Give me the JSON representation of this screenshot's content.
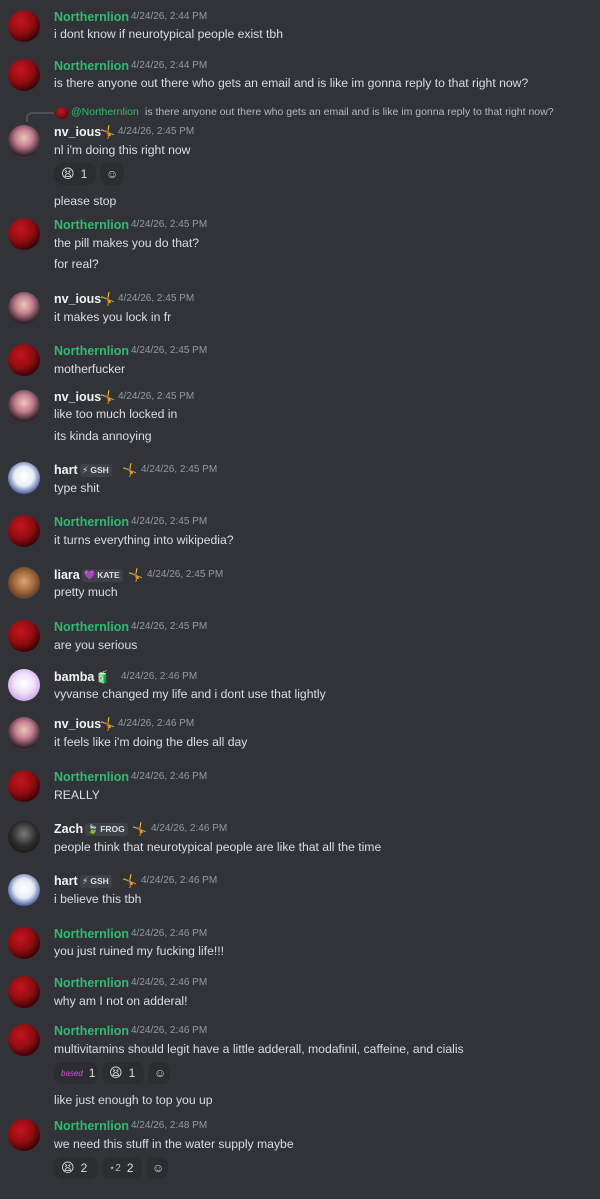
{
  "colors": {
    "background": "#313338",
    "northernlion": "#2dbd6e",
    "timestamp": "#949ba4",
    "text": "#dbdee1"
  },
  "messages": [
    {
      "name": "Northernlion",
      "time": "4/24/26, 2:44 PM",
      "text": "i dont know if neurotypical people exist tbh"
    },
    {
      "name": "Northernlion",
      "time": "4/24/26, 2:44 PM",
      "text": "is there anyone out there who gets an email and is like im gonna reply to that right now?"
    },
    {
      "reply_name": "@Northernlion",
      "reply_text": "is there anyone out there who gets an email and is like im gonna reply to that right now?",
      "name": "nv_ious",
      "time": "4/24/26, 2:45 PM",
      "text": "nl i'm doing this right now",
      "reaction_count": "1",
      "extra": "please stop"
    },
    {
      "name": "Northernlion",
      "time": "4/24/26, 2:45 PM",
      "text": "the pill makes you do that?",
      "extra": "for real?"
    },
    {
      "name": "nv_ious",
      "time": "4/24/26, 2:45 PM",
      "text": "it makes you lock in fr"
    },
    {
      "name": "Northernlion",
      "time": "4/24/26, 2:45 PM",
      "text": "motherfucker"
    },
    {
      "name": "nv_ious",
      "time": "4/24/26, 2:45 PM",
      "text": "like too much locked in",
      "extra": "its kinda annoying"
    },
    {
      "name": "hart",
      "tag": "GSH",
      "time": "4/24/26, 2:45 PM",
      "text": "type shit"
    },
    {
      "name": "Northernlion",
      "time": "4/24/26, 2:45 PM",
      "text": "it turns everything into wikipedia?"
    },
    {
      "name": "liara",
      "tag": "KATE",
      "time": "4/24/26, 2:45 PM",
      "text": "pretty much"
    },
    {
      "name": "Northernlion",
      "time": "4/24/26, 2:45 PM",
      "text": "are you serious"
    },
    {
      "name": "bamba",
      "time": "4/24/26, 2:46 PM",
      "text": "vyvanse changed my life and i dont use that lightly"
    },
    {
      "name": "nv_ious",
      "time": "4/24/26, 2:46 PM",
      "text": "it feels like i'm doing the dles all day"
    },
    {
      "name": "Northernlion",
      "time": "4/24/26, 2:46 PM",
      "text": "REALLY"
    },
    {
      "name": "Zach",
      "tag": "FROG",
      "time": "4/24/26, 2:46 PM",
      "text": "people think that neurotypical people are like that all the time"
    },
    {
      "name": "hart",
      "tag": "GSH",
      "time": "4/24/26, 2:46 PM",
      "text": "i believe this tbh"
    },
    {
      "name": "Northernlion",
      "time": "4/24/26, 2:46 PM",
      "text": "you just ruined my fucking life!!!"
    },
    {
      "name": "Northernlion",
      "time": "4/24/26, 2:46 PM",
      "text": "why am I not on adderal!"
    },
    {
      "name": "Northernlion",
      "time": "4/24/26, 2:46 PM",
      "text": "multivitamins should legit have a little adderall, modafinil, caffeine, and cialis",
      "reactions": [
        {
          "label": "based",
          "count": "1"
        },
        {
          "count": "1"
        }
      ],
      "extra": "like just enough to top you up"
    },
    {
      "name": "Northernlion",
      "time": "4/24/26, 2:48 PM",
      "text": "we need this stuff in the water supply maybe",
      "reactions": [
        {
          "count": "2"
        },
        {
          "count": "2"
        }
      ]
    }
  ]
}
